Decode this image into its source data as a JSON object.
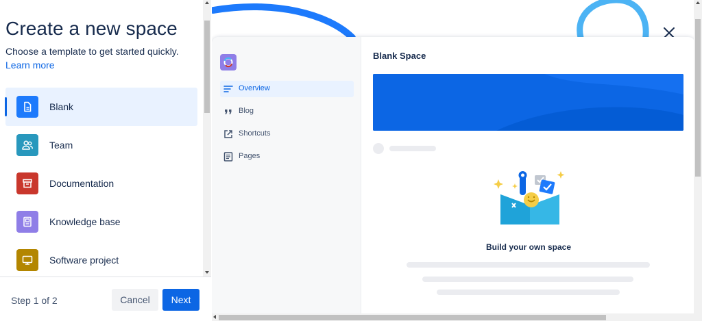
{
  "sidebar": {
    "title": "Create a new space",
    "subtitle": "Choose a template to get started quickly.",
    "learn_more": "Learn more",
    "templates": [
      {
        "label": "Blank",
        "icon": "document-icon",
        "color": "#1d7afc",
        "selected": true
      },
      {
        "label": "Team",
        "icon": "people-icon",
        "color": "#2898bd",
        "selected": false
      },
      {
        "label": "Documentation",
        "icon": "archive-icon",
        "color": "#c9372c",
        "selected": false
      },
      {
        "label": "Knowledge base",
        "icon": "book-icon",
        "color": "#8f7ee7",
        "selected": false
      },
      {
        "label": "Software project",
        "icon": "monitor-icon",
        "color": "#b38600",
        "selected": false
      }
    ]
  },
  "footer": {
    "step": "Step 1 of 2",
    "cancel_label": "Cancel",
    "next_label": "Next"
  },
  "preview": {
    "space_title": "Blank Space",
    "nav": [
      {
        "label": "Overview",
        "icon": "lines-icon",
        "active": true
      },
      {
        "label": "Blog",
        "icon": "quote-icon",
        "active": false
      },
      {
        "label": "Shortcuts",
        "icon": "external-link-icon",
        "active": false
      },
      {
        "label": "Pages",
        "icon": "page-icon",
        "active": false
      }
    ],
    "empty_state_title": "Build your own space",
    "banner_color": "#0c66e4"
  },
  "colors": {
    "accent": "#0c66e4",
    "selected_bg": "#e9f2ff",
    "text": "#172b4d"
  }
}
